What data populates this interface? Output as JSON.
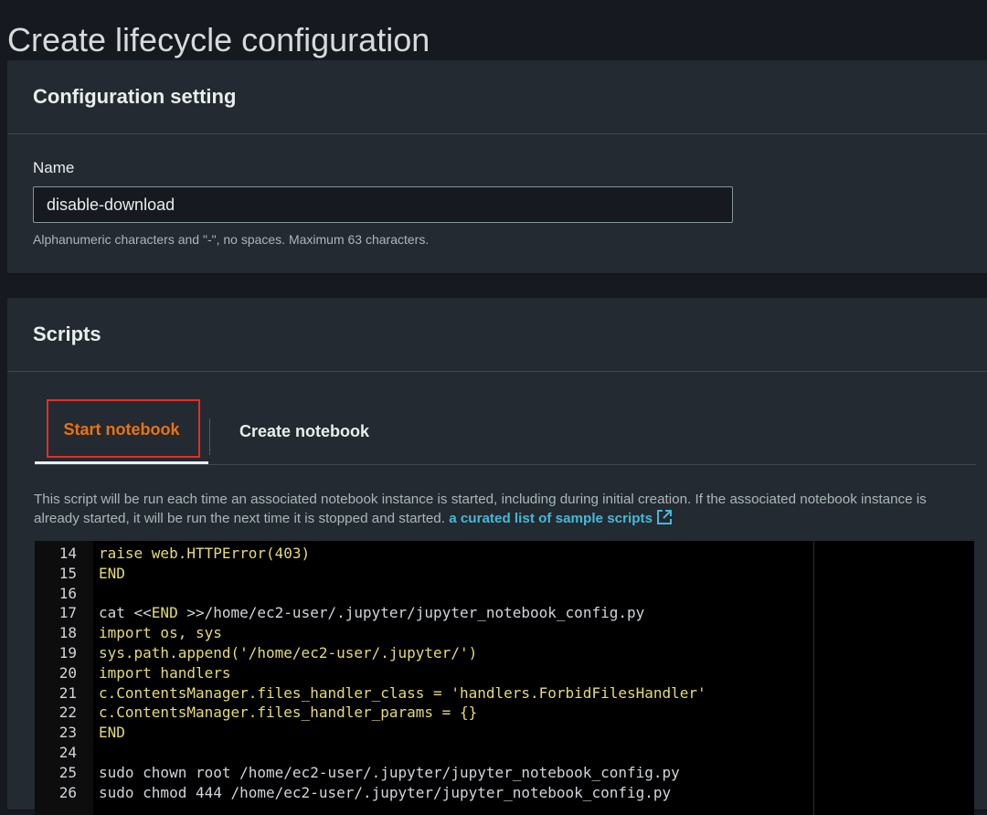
{
  "page": {
    "title": "Create lifecycle configuration"
  },
  "config_setting": {
    "heading": "Configuration setting",
    "name_label": "Name",
    "name_value": "disable-download",
    "name_hint": "Alphanumeric characters and \"-\", no spaces. Maximum 63 characters."
  },
  "scripts": {
    "heading": "Scripts",
    "tabs": [
      {
        "label": "Start notebook",
        "selected": true
      },
      {
        "label": "Create notebook",
        "selected": false
      }
    ],
    "description": "This script will be run each time an associated notebook instance is started, including during initial creation. If the associated notebook instance is already started, it will be run the next time it is stopped and started.",
    "sample_link": "a curated list of sample scripts",
    "code_lines": [
      {
        "n": "14",
        "text": "raise web.HTTPError(403)"
      },
      {
        "n": "15",
        "text": "END"
      },
      {
        "n": "16",
        "text": ""
      },
      {
        "n": "17",
        "text": "cat <<END >>/home/ec2-user/.jupyter/jupyter_notebook_config.py"
      },
      {
        "n": "18",
        "text": "import os, sys"
      },
      {
        "n": "19",
        "text": "sys.path.append('/home/ec2-user/.jupyter/')"
      },
      {
        "n": "20",
        "text": "import handlers"
      },
      {
        "n": "21",
        "text": "c.ContentsManager.files_handler_class = 'handlers.ForbidFilesHandler'"
      },
      {
        "n": "22",
        "text": "c.ContentsManager.files_handler_params = {}"
      },
      {
        "n": "23",
        "text": "END"
      },
      {
        "n": "24",
        "text": ""
      },
      {
        "n": "25",
        "text": "sudo chown root /home/ec2-user/.jupyter/jupyter_notebook_config.py"
      },
      {
        "n": "26",
        "text": "sudo chmod 444 /home/ec2-user/.jupyter/jupyter_notebook_config.py"
      }
    ]
  },
  "colors": {
    "accent_orange": "#ec7211",
    "link_blue": "#44b9d6",
    "highlight_red": "#e0302a",
    "code_yellow": "#e6db74"
  }
}
